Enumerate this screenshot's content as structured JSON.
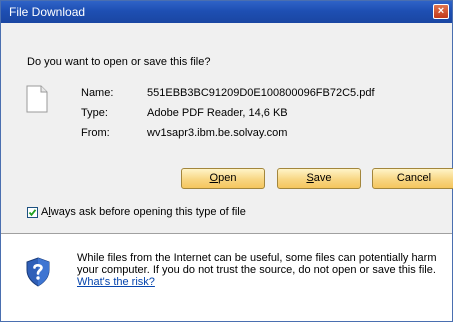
{
  "window": {
    "title": "File Download",
    "close_glyph": "×"
  },
  "prompt": "Do you want to open or save this file?",
  "file": {
    "icon": "document-icon",
    "name_label": "Name:",
    "name": "551EBB3BC91209D0E100800096FB72C5.pdf",
    "type_label": "Type:",
    "type": "Adobe PDF Reader, 14,6 KB",
    "from_label": "From:",
    "from": "wv1sapr3.ibm.be.solvay.com"
  },
  "buttons": {
    "open": {
      "first": "O",
      "rest": "pen"
    },
    "save": {
      "first": "S",
      "rest": "ave"
    },
    "cancel": "Cancel"
  },
  "checkbox": {
    "checked": true,
    "prefix": "A",
    "accel": "l",
    "rest": "ways ask before opening this type of file"
  },
  "warning": {
    "icon": "shield-question-icon",
    "text": "While files from the Internet can be useful, some files can potentially harm your computer. If you do not trust the source, do not open or save this file.",
    "link": "What's the risk?"
  }
}
